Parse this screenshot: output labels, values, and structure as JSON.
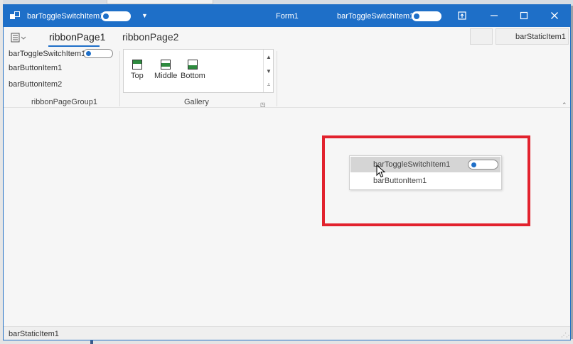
{
  "title_bar": {
    "qat_label": "barToggleSwitchItem1",
    "form_title": "Form1",
    "right_label": "barToggleSwitchItem1",
    "qat_dropdown_icon": "chevron-down-icon",
    "buttons": [
      {
        "name": "pin-icon",
        "glyph": "⊼"
      },
      {
        "name": "minimize-icon",
        "glyph": "–"
      },
      {
        "name": "maximize-icon",
        "glyph": "☐"
      },
      {
        "name": "close-icon",
        "glyph": "✕"
      }
    ]
  },
  "ribbon_tabs": [
    {
      "label": "ribbonPage1",
      "active": true
    },
    {
      "label": "ribbonPage2",
      "active": false
    }
  ],
  "header_static": "barStaticItem1",
  "ribbon_group1": {
    "toggle_label": "barToggleSwitchItem1",
    "button1": "barButtonItem1",
    "button2": "barButtonItem2",
    "caption": "ribbonPageGroup1"
  },
  "gallery": {
    "caption": "Gallery",
    "items": [
      {
        "label": "Top",
        "icon": "align-top-icon"
      },
      {
        "label": "Middle",
        "icon": "align-middle-icon"
      },
      {
        "label": "Bottom",
        "icon": "align-bottom-icon"
      }
    ],
    "scroll_glyphs": {
      "up": "▲",
      "down": "▼",
      "more": "⩡"
    }
  },
  "popup_menu": {
    "items": [
      {
        "label": "barToggleSwitchItem1",
        "hover": true,
        "has_toggle": true
      },
      {
        "label": "barButtonItem1",
        "hover": false,
        "has_toggle": false
      }
    ]
  },
  "status_bar": {
    "text": "barStaticItem1"
  },
  "colors": {
    "accent": "#1e6fc8",
    "highlight_frame": "#e2222d",
    "gallery_fill": "#2e8b3f"
  }
}
